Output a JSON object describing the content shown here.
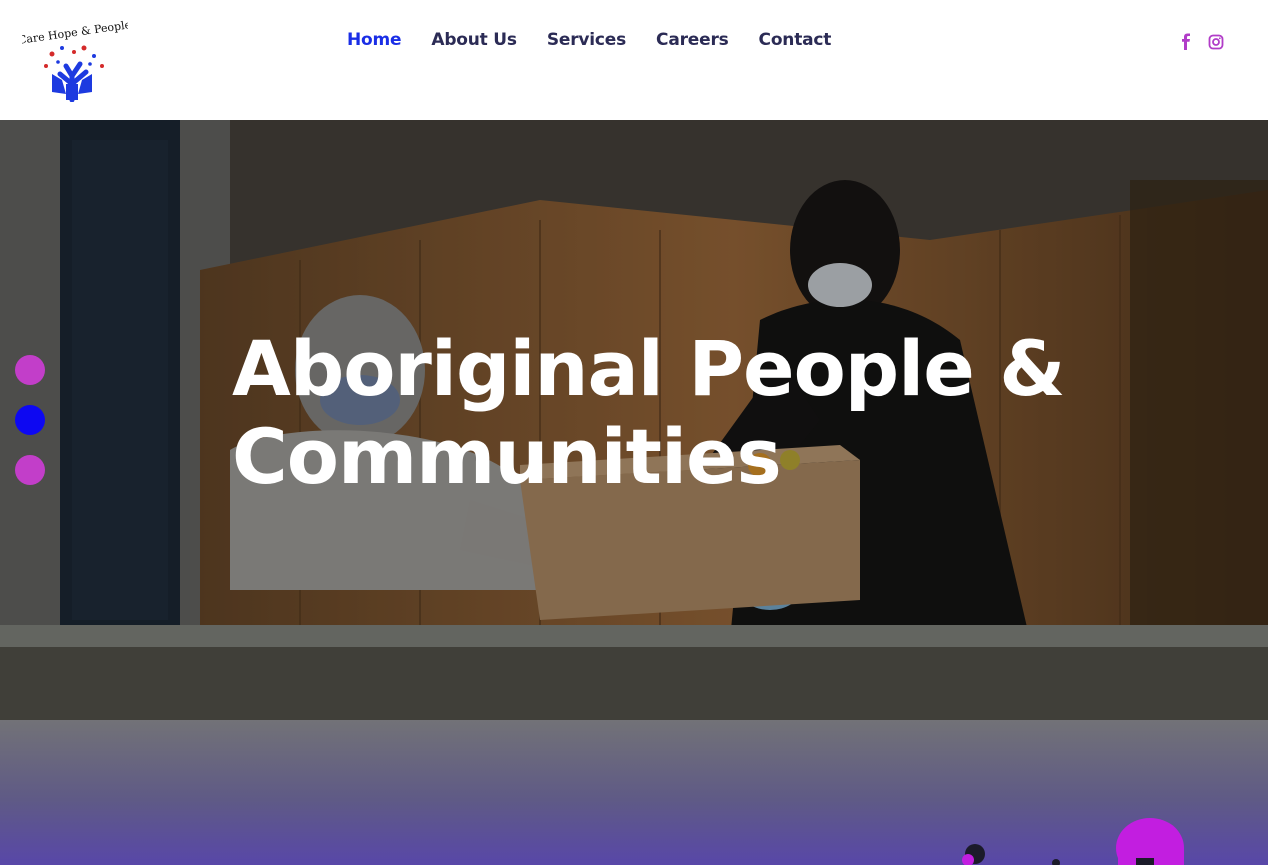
{
  "logo": {
    "text": "Care Hope & People"
  },
  "nav": {
    "items": [
      {
        "label": "Home",
        "active": true
      },
      {
        "label": "About Us",
        "active": false
      },
      {
        "label": "Services",
        "active": false
      },
      {
        "label": "Careers",
        "active": false
      },
      {
        "label": "Contact",
        "active": false
      }
    ]
  },
  "social": {
    "facebook_icon": "facebook-icon",
    "instagram_icon": "instagram-icon",
    "color": "#b13cc8"
  },
  "hero": {
    "title_line1": "Aboriginal People &",
    "title_line2": "Communities"
  },
  "slider": {
    "dot_colors": [
      "#c23ec9",
      "#0d08f2",
      "#c23ec9"
    ]
  },
  "colors": {
    "accent": "#1a2ee6",
    "nav_text": "#2b2b55",
    "purple": "#c23ec9"
  }
}
